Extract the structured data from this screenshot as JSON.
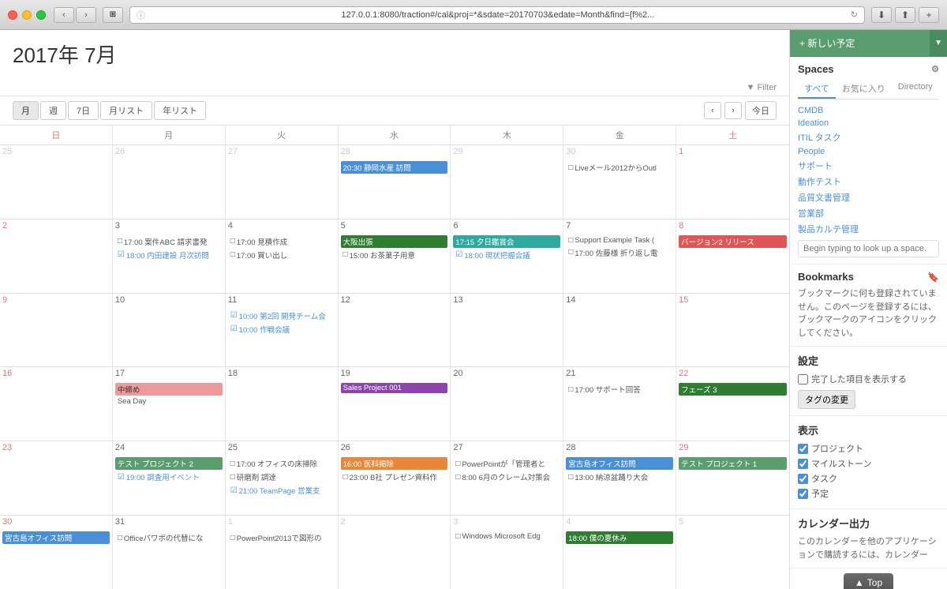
{
  "titlebar": {
    "url": "127.0.0.1:8080/traction#/cal&proj=*&sdate=20170703&edate=Month&find={f%2..."
  },
  "calendar": {
    "title": "2017年 7月",
    "view_tabs": [
      "月",
      "週",
      "7日",
      "月リスト",
      "年リスト"
    ],
    "active_tab": "月",
    "today_label": "今日",
    "filter_label": "▼ Filter",
    "days_of_week": [
      "日",
      "月",
      "火",
      "水",
      "木",
      "金",
      "土"
    ],
    "weeks": [
      {
        "days": [
          {
            "num": "25",
            "other": true,
            "events": []
          },
          {
            "num": "26",
            "other": true,
            "events": []
          },
          {
            "num": "27",
            "other": true,
            "events": []
          },
          {
            "num": "28",
            "other": true,
            "events": [
              {
                "text": "20:30 静岡水産 訪問",
                "type": "blue"
              }
            ]
          },
          {
            "num": "29",
            "other": true,
            "events": []
          },
          {
            "num": "30",
            "other": true,
            "events": [
              {
                "text": "Liveメール2012からOutl",
                "type": "checkbox"
              }
            ]
          },
          {
            "num": "1",
            "events": []
          }
        ]
      },
      {
        "days": [
          {
            "num": "2",
            "events": []
          },
          {
            "num": "3",
            "events": [
              {
                "text": "17:00 案件ABC 請求書発",
                "type": "checkbox"
              },
              {
                "text": "18:00 内田建設 月次訪問",
                "type": "checked-blue"
              }
            ]
          },
          {
            "num": "4",
            "events": [
              {
                "text": "17:00 見積作成",
                "type": "checkbox"
              },
              {
                "text": "17:00 買い出し",
                "type": "checkbox"
              }
            ]
          },
          {
            "num": "5",
            "events": [
              {
                "text": "大阪出張",
                "type": "dark-green"
              },
              {
                "text": "15:00 お茶菓子用意",
                "type": "checkbox"
              }
            ]
          },
          {
            "num": "6",
            "events": [
              {
                "text": "17:15 夕日鑑賞会",
                "type": "teal"
              },
              {
                "text": "18:00 現状把握会議",
                "type": "checked-blue"
              }
            ]
          },
          {
            "num": "7",
            "events": [
              {
                "text": "Support Example Task (",
                "type": "checkbox"
              },
              {
                "text": "17:00 佐藤様 折り返し電",
                "type": "checkbox"
              }
            ]
          },
          {
            "num": "8",
            "events": [
              {
                "text": "バージョン2 リリース",
                "type": "red"
              }
            ]
          }
        ]
      },
      {
        "days": [
          {
            "num": "9",
            "events": []
          },
          {
            "num": "10",
            "events": []
          },
          {
            "num": "11",
            "events": [
              {
                "text": "10:00 第2回 開発チーム会",
                "type": "checked-blue"
              },
              {
                "text": "10:00 作戦会議",
                "type": "checked-blue"
              }
            ]
          },
          {
            "num": "12",
            "events": []
          },
          {
            "num": "13",
            "events": []
          },
          {
            "num": "14",
            "events": []
          },
          {
            "num": "15",
            "events": []
          }
        ]
      },
      {
        "days": [
          {
            "num": "16",
            "events": []
          },
          {
            "num": "17",
            "events": [
              {
                "text": "中締め",
                "type": "light-red"
              },
              {
                "text": "Sea Day",
                "type": ""
              }
            ]
          },
          {
            "num": "18",
            "events": []
          },
          {
            "num": "19",
            "events": [
              {
                "text": "Sales Project 001",
                "type": "purple"
              }
            ]
          },
          {
            "num": "20",
            "events": []
          },
          {
            "num": "21",
            "events": [
              {
                "text": "17:00 サポート回答",
                "type": "checkbox"
              }
            ]
          },
          {
            "num": "22",
            "events": [
              {
                "text": "フェーズ 3",
                "type": "dark-green"
              }
            ]
          }
        ]
      },
      {
        "days": [
          {
            "num": "23",
            "events": []
          },
          {
            "num": "24",
            "events": [
              {
                "text": "テスト プロジェクト 2",
                "type": "green"
              },
              {
                "text": "19:00 調査用イベント",
                "type": "checked-blue"
              }
            ]
          },
          {
            "num": "25",
            "events": [
              {
                "text": "17:00 オフィスの床掃除",
                "type": "checkbox"
              },
              {
                "text": "研磨剤 調達",
                "type": "checkbox"
              },
              {
                "text": "21:00 TeamPage 営業支",
                "type": "checked-blue"
              }
            ]
          },
          {
            "num": "26",
            "events": [
              {
                "text": "16:00 医科掲除",
                "type": "orange"
              },
              {
                "text": "23:00 B社 プレゼン資料作",
                "type": "checkbox"
              }
            ]
          },
          {
            "num": "27",
            "events": [
              {
                "text": "PowerPointが「管理者と",
                "type": "checkbox"
              },
              {
                "text": "8:00 6月のクレーム対策会",
                "type": "checkbox"
              }
            ]
          },
          {
            "num": "28",
            "events": [
              {
                "text": "宮古島オフィス訪問",
                "type": "blue"
              },
              {
                "text": "13:00 納涼盆踊り大会",
                "type": "checkbox"
              }
            ]
          },
          {
            "num": "29",
            "events": [
              {
                "text": "テスト プロジェクト 1",
                "type": "green"
              }
            ]
          }
        ]
      },
      {
        "days": [
          {
            "num": "30",
            "events": [
              {
                "text": "宮古島オフィス訪問",
                "type": "blue"
              }
            ]
          },
          {
            "num": "31",
            "events": [
              {
                "text": "Officeパワポの代替にな",
                "type": "checkbox"
              }
            ]
          },
          {
            "num": "1",
            "other": true,
            "events": [
              {
                "text": "PowerPoint2013で図形の",
                "type": "checkbox"
              }
            ]
          },
          {
            "num": "2",
            "other": true,
            "events": []
          },
          {
            "num": "3",
            "other": true,
            "events": [
              {
                "text": "Windows Microsoft Edg",
                "type": "checkbox"
              }
            ]
          },
          {
            "num": "4",
            "other": true,
            "events": [
              {
                "text": "18:00 僕の夏休み",
                "type": "dark-green"
              }
            ]
          },
          {
            "num": "5",
            "other": true,
            "events": []
          }
        ]
      }
    ]
  },
  "sidebar": {
    "new_event_label": "+ 新しい予定",
    "new_event_arrow": "▼",
    "spaces_title": "Spaces",
    "spaces_tabs": [
      "すべて",
      "お気に入り",
      "Directory"
    ],
    "active_spaces_tab": "すべて",
    "space_items": [
      "CMDB",
      "Ideation",
      "ITIL タスク",
      "People",
      "サポート",
      "動作テスト",
      "品質文書管理",
      "営業部",
      "製品カルテ管理"
    ],
    "space_search_placeholder": "Begin typing to look up a space.",
    "bookmarks_title": "Bookmarks",
    "bookmarks_text": "ブックマークに何も登録されていません。このページを登録するには、ブックマークのアイコンをクリックしてください。",
    "settings_title": "設定",
    "settings_items": [
      "完了した項目を表示する"
    ],
    "tags_btn_label": "タグの変更",
    "display_title": "表示",
    "display_items": [
      "プロジェクト",
      "マイルストーン",
      "タスク",
      "予定"
    ],
    "cal_output_title": "カレンダー出力",
    "cal_output_text": "このカレンダーを他のアプリケーションで購読するには、カレンダー",
    "top_btn_label": "Top"
  }
}
